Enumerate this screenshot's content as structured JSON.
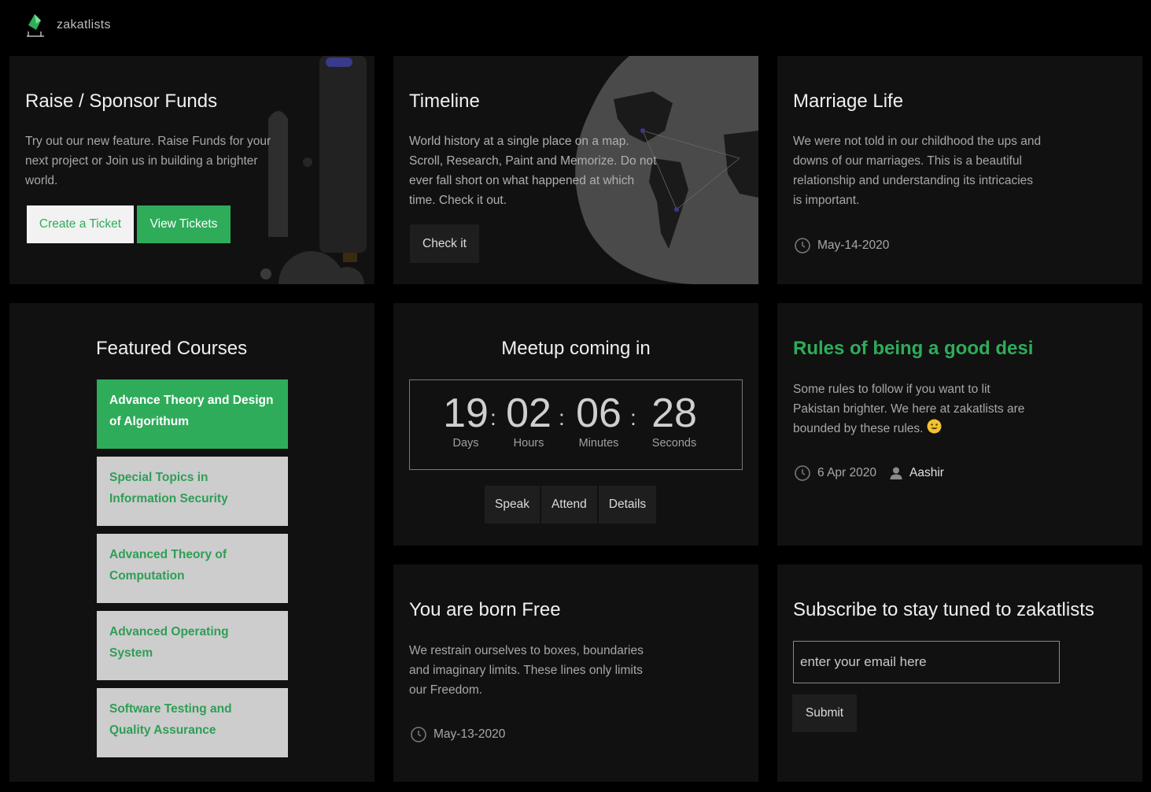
{
  "brand": {
    "name": "zakatlists"
  },
  "sponsor": {
    "title": "Raise / Sponsor Funds",
    "text": "Try out our new feature. Raise Funds for your next project or Join us in building a brighter world.",
    "create_label": "Create a Ticket",
    "view_label": "View Tickets"
  },
  "timeline": {
    "title": "Timeline",
    "text": "World history at a single place on a map. Scroll, Research, Paint and Memorize. Do not ever fall short on what happened at which time. Check it out.",
    "button_label": "Check it"
  },
  "marriage": {
    "title": "Marriage Life",
    "text": "We were not told in our childhood the ups and downs of our marriages. This is a beautiful relationship and understanding its intricacies is important.",
    "date": "May-14-2020"
  },
  "featured": {
    "title": "Featured Courses",
    "courses": [
      {
        "label": "Advance Theory and Design of Algorithum"
      },
      {
        "label": "Special Topics in Information Security"
      },
      {
        "label": "Advanced Theory of Computation"
      },
      {
        "label": "Advanced Operating System"
      },
      {
        "label": "Software Testing and Quality Assurance"
      }
    ]
  },
  "meetup": {
    "title": "Meetup coming in",
    "days": "19",
    "hours": "02",
    "minutes": "06",
    "seconds": "28",
    "days_label": "Days",
    "hours_label": "Hours",
    "minutes_label": "Minutes",
    "seconds_label": "Seconds",
    "speak_label": "Speak",
    "attend_label": "Attend",
    "details_label": "Details"
  },
  "rules": {
    "title": "Rules of being a good desi",
    "text": "Some rules to follow if you want to lit Pakistan brighter. We here at zakatlists are bounded by these rules.",
    "date": "6 Apr 2020",
    "author": "Aashir"
  },
  "born_free": {
    "title": "You are born Free",
    "text": "We restrain ourselves to boxes, boundaries and imaginary limits. These lines only limits our Freedom.",
    "date": "May-13-2020"
  },
  "subscribe": {
    "title": "Subscribe to stay tuned to zakatlists",
    "placeholder": "enter your email here",
    "submit_label": "Submit"
  },
  "colors": {
    "accent": "#2eac5a",
    "card": "#111111",
    "background": "#000000"
  }
}
